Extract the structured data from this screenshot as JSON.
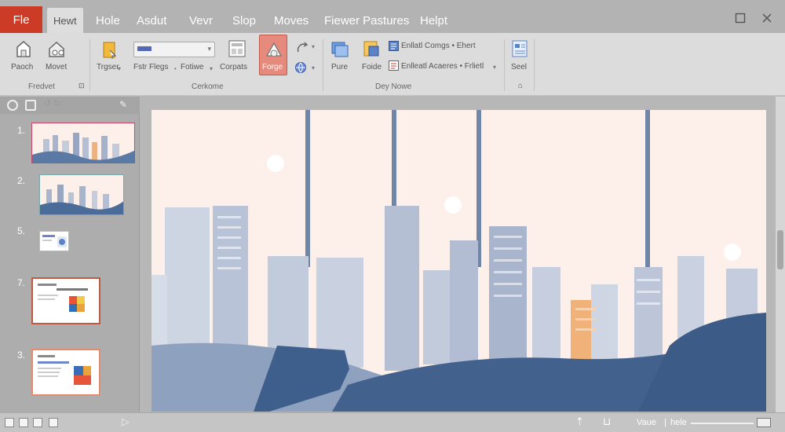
{
  "tabs": {
    "file": "Fle",
    "items": [
      "Hewt",
      "Hole",
      "Asdut",
      "Vevr",
      "Slop",
      "Moves",
      "Fiewer Pastures",
      "Helpt"
    ],
    "active_index": 0
  },
  "window": {
    "restore_icon": "restore-icon",
    "close_icon": "close-icon"
  },
  "ribbon": {
    "group1": {
      "label": "Fredvet",
      "buttons": [
        "Paoch",
        "Movet"
      ]
    },
    "group2": {
      "label": "Cerkome",
      "buttons": [
        "Trgser",
        "Fstr Flegs",
        "Fotiwe",
        "Corpats",
        "Forge"
      ]
    },
    "group3": {
      "label": "Dey Nowe",
      "buttons": [
        "Pure",
        "Foide"
      ],
      "rows": [
        "Enllatl Comgs • Ehert",
        "Enlleatl Acaeres • Frlietl"
      ]
    },
    "group4": {
      "label": "",
      "buttons": [
        "Seel"
      ]
    }
  },
  "slides_panel": {
    "numbers": [
      "1.",
      "2.",
      "5.",
      "7.",
      "3."
    ]
  },
  "accent_colors": {
    "file_tab": "#cb3b26",
    "slide_bg": "#fdf0ea",
    "wave_dark": "#42628d",
    "building_orange": "#f1b27a"
  },
  "statusbar": {
    "view_label": "Vaue",
    "separator": "|",
    "hide_label": "hele"
  }
}
